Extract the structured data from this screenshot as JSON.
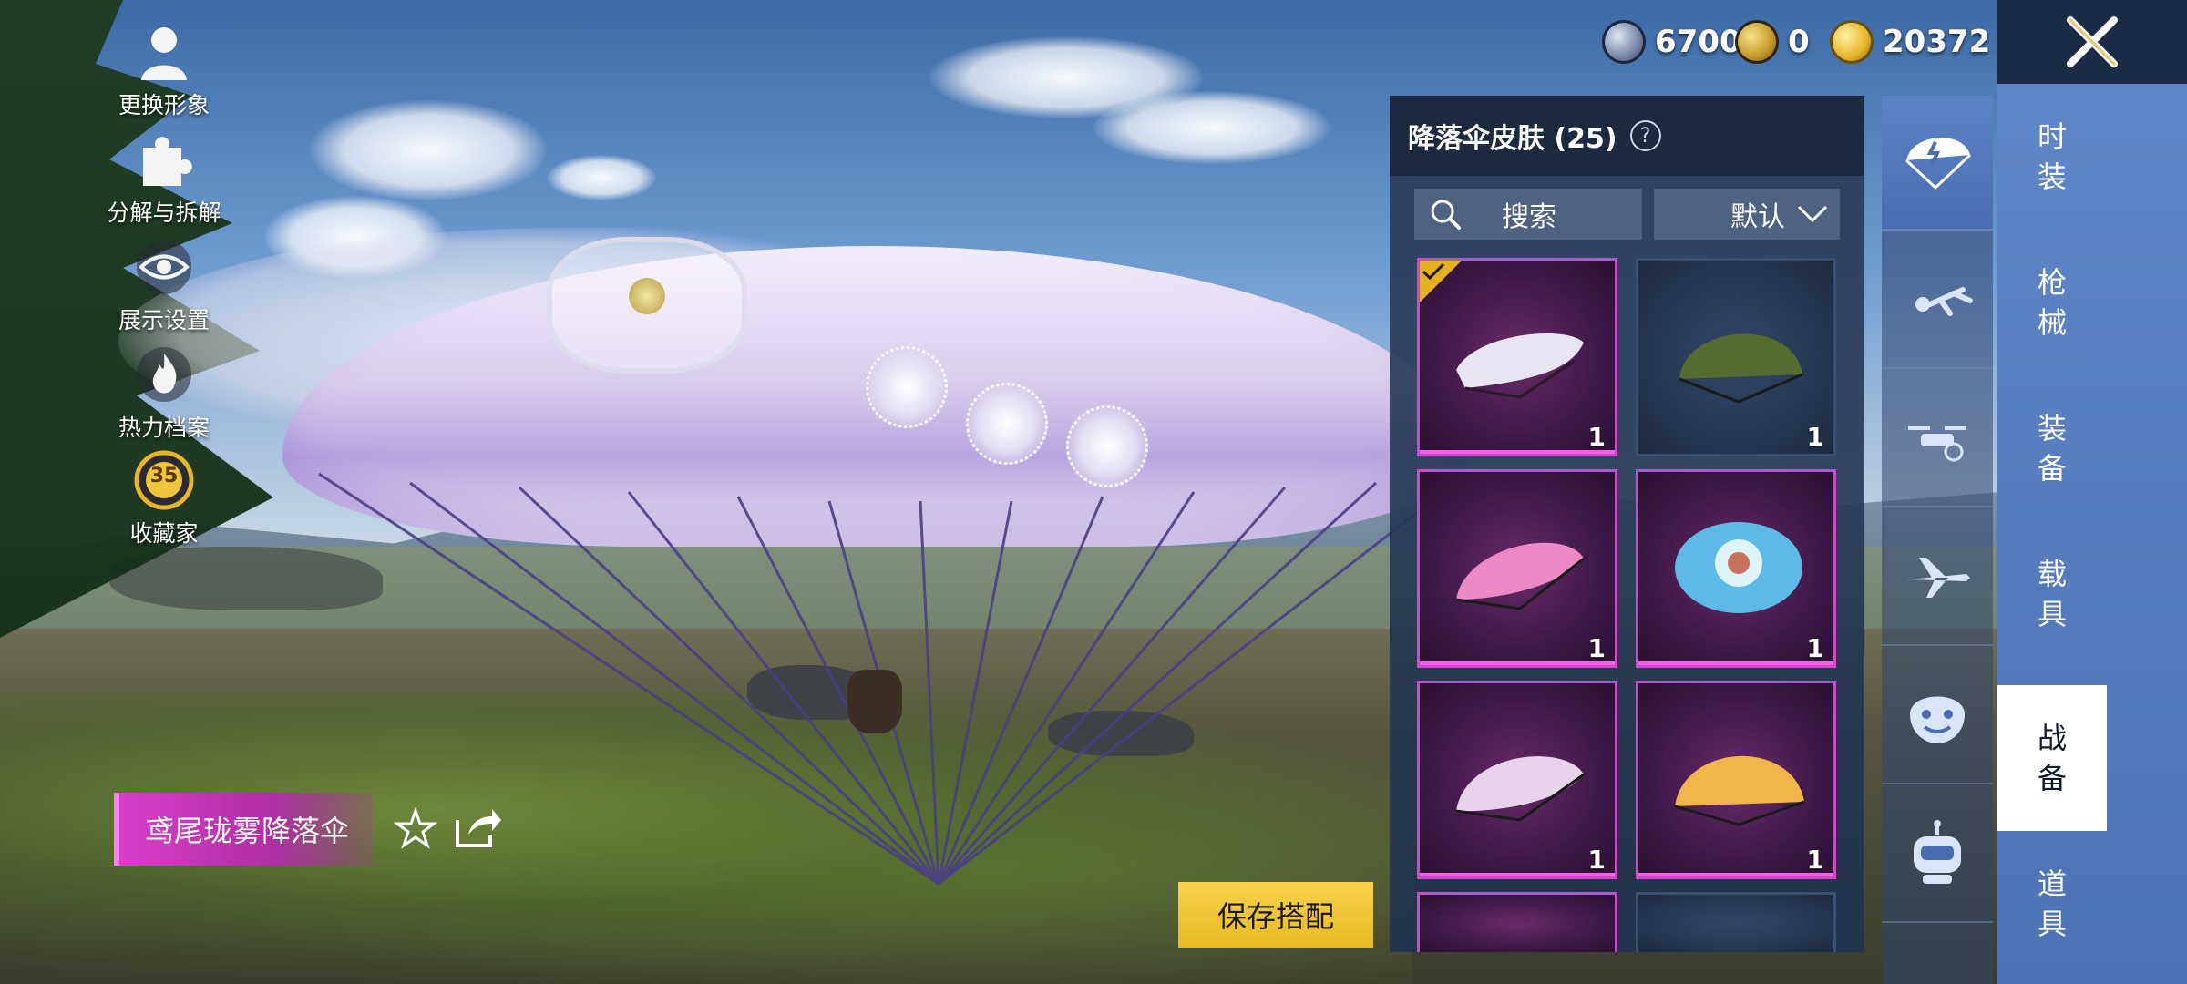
{
  "left_menu": [
    {
      "label": "更换形象",
      "icon": "person-icon"
    },
    {
      "label": "分解与拆解",
      "icon": "puzzle-icon"
    },
    {
      "label": "展示设置",
      "icon": "eye-icon"
    },
    {
      "label": "热力档案",
      "icon": "flame-icon"
    },
    {
      "label": "收藏家",
      "icon": "collector-badge-icon",
      "level": "35"
    }
  ],
  "currencies": [
    {
      "name": "silver-coin",
      "value": "6700"
    },
    {
      "name": "ag-coin",
      "value": "0"
    },
    {
      "name": "bp-coin",
      "value": "20372"
    }
  ],
  "panel": {
    "title": "降落伞皮肤 (25)",
    "search_label": "搜索",
    "sort_label": "默认"
  },
  "items": [
    {
      "qty": "1",
      "rarity": "purple",
      "selected": true,
      "color": "#e9e4f2"
    },
    {
      "qty": "1",
      "rarity": "navy",
      "selected": false,
      "color": "#556b2f"
    },
    {
      "qty": "1",
      "rarity": "purple",
      "selected": false,
      "color": "#ec8ac8"
    },
    {
      "qty": "1",
      "rarity": "purple",
      "selected": false,
      "color": "#5fb9e6"
    },
    {
      "qty": "1",
      "rarity": "purple",
      "selected": false,
      "color": "#e7d3ea"
    },
    {
      "qty": "1",
      "rarity": "purple",
      "selected": false,
      "color": "#f2b54a"
    }
  ],
  "categories": [
    {
      "icon": "parachute-icon",
      "active": true
    },
    {
      "icon": "skydiver-icon",
      "active": false
    },
    {
      "icon": "drone-icon",
      "active": false
    },
    {
      "icon": "airplane-icon",
      "active": false
    },
    {
      "icon": "emote-icon",
      "active": false
    },
    {
      "icon": "robot-icon",
      "active": false
    }
  ],
  "tabs": [
    {
      "label": "时装",
      "active": false
    },
    {
      "label": "枪械",
      "active": false
    },
    {
      "label": "装备",
      "active": false
    },
    {
      "label": "载具",
      "active": false
    },
    {
      "label": "战备",
      "active": true
    },
    {
      "label": "道具",
      "active": false
    }
  ],
  "item_name": "鸢尾珑雾降落伞",
  "save_button": "保存搭配",
  "colors": {
    "accent_pink": "#d246c8",
    "save_yellow": "#f7d24a",
    "tab_blue": "#5f86c8"
  }
}
